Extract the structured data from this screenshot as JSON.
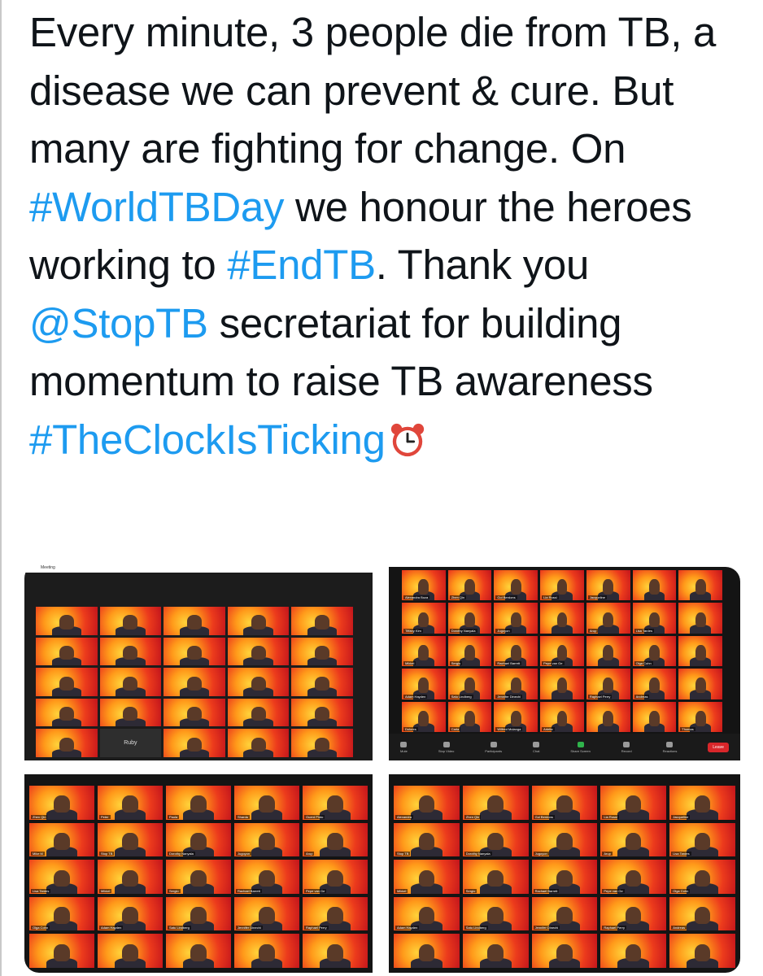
{
  "tweet": {
    "segments": [
      {
        "text": "Every minute, 3 people die from TB, a disease we can prevent & cure. But many are fighting for change. On ",
        "link": false
      },
      {
        "text": "#WorldTBDay",
        "link": true
      },
      {
        "text": " we honour the heroes working to ",
        "link": false
      },
      {
        "text": "#EndTB",
        "link": true
      },
      {
        "text": ". Thank you ",
        "link": false
      },
      {
        "text": "@StopTB",
        "link": true
      },
      {
        "text": " secretariat for building momentum to raise TB awareness ",
        "link": false
      },
      {
        "text": "#TheClockIsTicking",
        "link": true
      }
    ],
    "emoji": "alarm-clock-icon",
    "colors": {
      "text": "#0f1419",
      "link": "#1d9bf0"
    }
  },
  "media": {
    "shot1": {
      "header": "Meeting",
      "tiles": [
        "",
        "",
        "",
        "",
        "",
        "",
        "",
        "",
        "",
        "",
        "",
        "",
        "",
        "",
        "",
        "",
        "",
        "",
        "",
        "",
        "",
        "Ruby",
        "",
        "",
        ""
      ]
    },
    "shot2": {
      "tiles": [
        "Alexandra Boza",
        "Zhen Qin",
        "Gol Berdons",
        "Lia Rossi",
        "Jacqueline",
        "",
        "",
        "Tiffany Kim",
        "Dorothy Nanyala",
        "Jugoyon",
        "",
        "Arup",
        "Lisa Tardes",
        "",
        "Mikkel",
        "Sergio",
        "Rachael Barrett",
        "Pepe van Ge",
        "",
        "Olga Cohn",
        "",
        "Adam Hayden",
        "Satu Lindberg",
        "Jennifer Dinechi",
        "",
        "Raphael Perry",
        "Andreas",
        "",
        "Dolores",
        "Carla",
        "Wilfred Mulanga",
        "Arlette",
        "",
        "",
        "Thomas"
      ],
      "toolbar": [
        "Mute",
        "Stop Video",
        "Participants",
        "Chat",
        "Share Screen",
        "Record",
        "Reactions"
      ],
      "leave": "Leave"
    },
    "shot3": {
      "tiles": [
        "Zhen Qin",
        "Peter",
        "Paula",
        "Sharda",
        "Ouerd Pinto",
        "Mike M",
        "Stop TB",
        "Dorothy Nanyala",
        "Jugoyon",
        "Arup",
        "Lisa Tardes",
        "Mikkel",
        "Sergio",
        "Rachael Barrett",
        "Pepe van Ge",
        "Olga Cohn",
        "Adam Hayden",
        "Satu Lindberg",
        "Jennifer Dinechi",
        "Raphael Perry",
        "",
        "",
        "",
        "",
        ""
      ]
    },
    "shot4": {
      "tiles": [
        "Alexandra",
        "Zhen Qin",
        "Gol Berdons",
        "Lia Rossi",
        "Jacqueline",
        "Stop TB",
        "Dorothy Nanyala",
        "Jugoyon",
        "Arup",
        "Lisa Tardes",
        "Mikkel",
        "Sergio",
        "Rachael Barrett",
        "Pepe van Ge",
        "Olga Cohn",
        "Adam Hayden",
        "Satu Lindberg",
        "Jennifer Dinechi",
        "Raphael Perry",
        "Andreas",
        "",
        "",
        "",
        "",
        ""
      ]
    }
  }
}
